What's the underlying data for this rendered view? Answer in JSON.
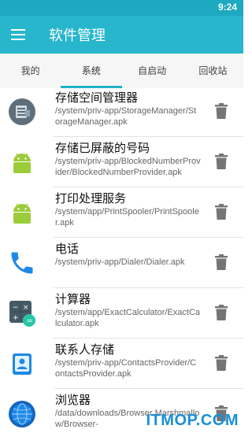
{
  "status_bar": {
    "time": "9:24"
  },
  "app_bar": {
    "title": "软件管理",
    "menu_icon": "hamburger-menu-icon"
  },
  "tabs": [
    {
      "label": "我的",
      "active": false
    },
    {
      "label": "系统",
      "active": true
    },
    {
      "label": "自启动",
      "active": false
    },
    {
      "label": "回收站",
      "active": false
    }
  ],
  "apps": [
    {
      "name": "存储空间管理器",
      "path": "/system/priv-app/StorageManager/StorageManager.apk",
      "icon": "storage-manager-icon"
    },
    {
      "name": "存储已屏蔽的号码",
      "path": "/system/priv-app/BlockedNumberProvider/BlockedNumberProvider.apk",
      "icon": "android-robot-icon"
    },
    {
      "name": "打印处理服务",
      "path": "/system/app/PrintSpooler/PrintSpooler.apk",
      "icon": "android-robot-icon"
    },
    {
      "name": "电话",
      "path": "/system/priv-app/Dialer/Dialer.apk",
      "icon": "phone-icon"
    },
    {
      "name": "计算器",
      "path": "/system/app/ExactCalculator/ExactCalculator.apk",
      "icon": "calculator-icon"
    },
    {
      "name": "联系人存储",
      "path": "/system/priv-app/ContactsProvider/ContactsProvider.apk",
      "icon": "contacts-icon"
    },
    {
      "name": "浏览器",
      "path": "/data/downloads/Browser Marshmallow/Browser-",
      "icon": "browser-globe-icon"
    }
  ],
  "delete_icon": "trash-can-icon",
  "watermark": "ITMOP.COM",
  "colors": {
    "accent": "#27b6cc",
    "status_bar": "#1da9c0",
    "tab_underline": "#22b1c8"
  }
}
